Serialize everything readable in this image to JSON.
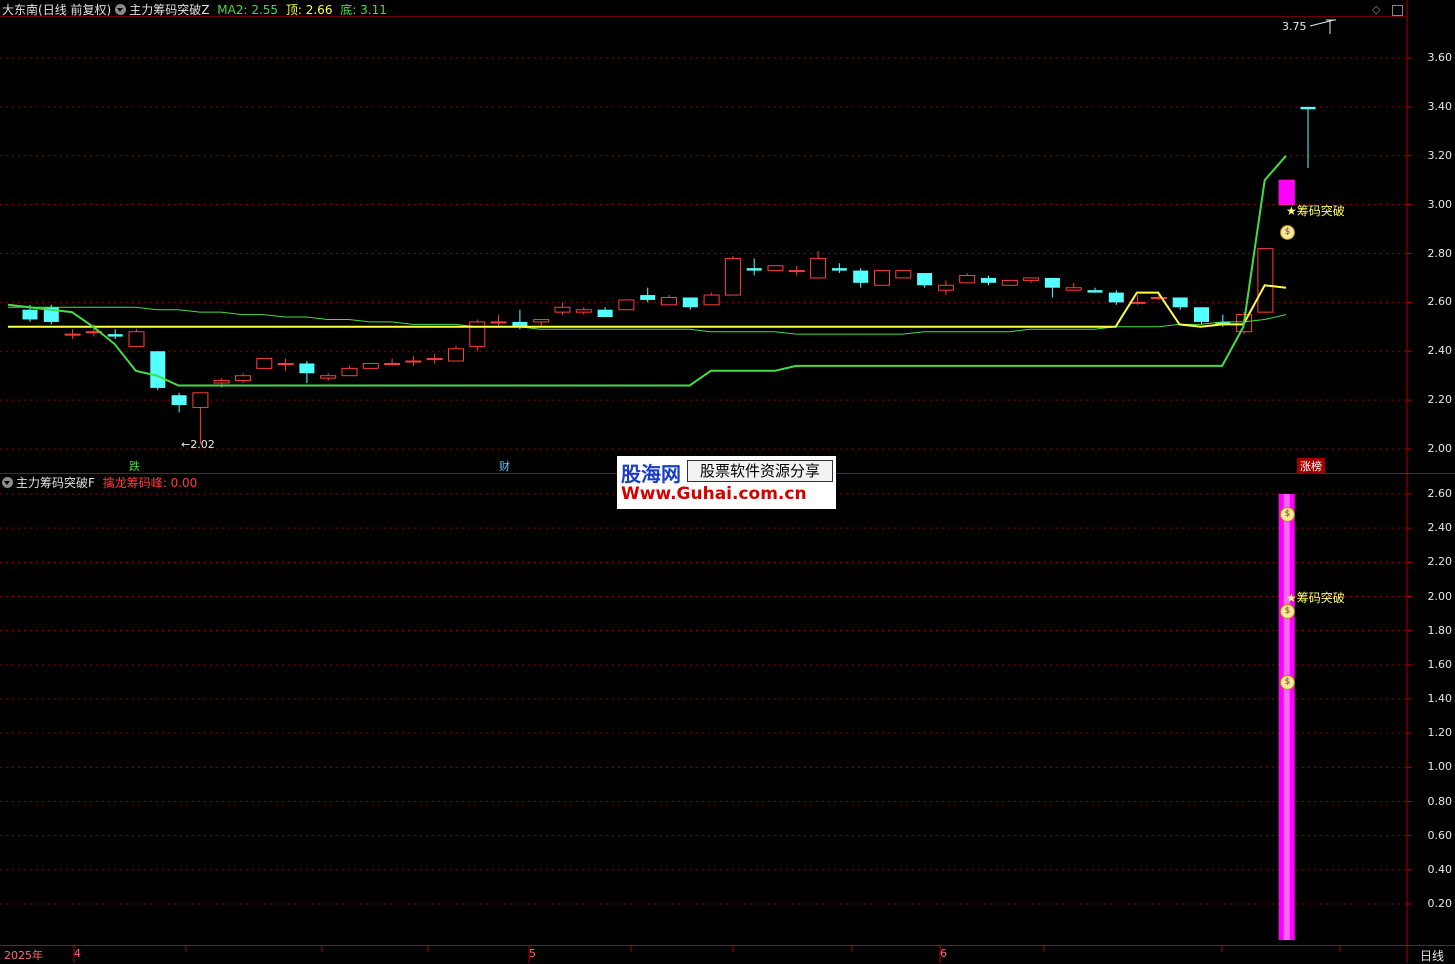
{
  "upper_panel": {
    "stock_name": "大东南",
    "period_info": "(日线 前复权)",
    "indicator_name": "主力筹码突破Z",
    "ma2_label": "MA2: 2.55",
    "top_label": "顶: 2.66",
    "bottom_label": "底: 3.11",
    "y_ticks": [
      "3.60",
      "3.40",
      "3.20",
      "3.00",
      "2.80",
      "2.60",
      "2.40",
      "2.20",
      "2.00"
    ],
    "high_annotation": "3.75",
    "low_annotation": "2.02",
    "signal_label": "★筹码突破",
    "markers": {
      "left": "跌",
      "middle": "财",
      "right": "涨榜"
    }
  },
  "lower_panel": {
    "indicator_name": "主力筹码突破F",
    "value_label": "擒龙筹码峰: 0.00",
    "y_ticks": [
      "2.60",
      "2.40",
      "2.20",
      "2.00",
      "1.80",
      "1.60",
      "1.40",
      "1.20",
      "1.00",
      "0.80",
      "0.60",
      "0.40",
      "0.20"
    ],
    "signal_label": "★筹码突破"
  },
  "x_axis": {
    "year_label": "2025年",
    "month_labels": [
      "4",
      "5",
      "6"
    ],
    "period_button": "日线"
  },
  "watermark": {
    "brand": "股海网",
    "slogan": "股票软件资源分享",
    "url": "Www.Guhai.com.cn"
  },
  "colors": {
    "up": "#ff3c3c",
    "down": "#54ffff",
    "ma_green": "#44dd44",
    "ma_yellow": "#ffff44",
    "bar_magenta": "#ff00ff",
    "grid": "#8b0000"
  },
  "icons": {
    "menu": "triangle-down-icon",
    "money": "money-bag-icon"
  },
  "chart_data": {
    "type": "candlestick",
    "ylim": [
      1.95,
      3.8
    ],
    "ohlc": [
      [
        2.57,
        2.59,
        2.52,
        2.53
      ],
      [
        2.58,
        2.59,
        2.51,
        2.52
      ],
      [
        2.47,
        2.49,
        2.45,
        2.47
      ],
      [
        2.48,
        2.51,
        2.46,
        2.48
      ],
      [
        2.47,
        2.49,
        2.45,
        2.46
      ],
      [
        2.42,
        2.49,
        2.42,
        2.48
      ],
      [
        2.4,
        2.4,
        2.24,
        2.25
      ],
      [
        2.22,
        2.23,
        2.15,
        2.18
      ],
      [
        2.17,
        2.23,
        2.02,
        2.23
      ],
      [
        2.27,
        2.29,
        2.25,
        2.28
      ],
      [
        2.28,
        2.31,
        2.27,
        2.3
      ],
      [
        2.33,
        2.37,
        2.33,
        2.37
      ],
      [
        2.35,
        2.37,
        2.32,
        2.35
      ],
      [
        2.35,
        2.36,
        2.27,
        2.31
      ],
      [
        2.29,
        2.31,
        2.28,
        2.3
      ],
      [
        2.3,
        2.34,
        2.3,
        2.33
      ],
      [
        2.33,
        2.35,
        2.33,
        2.35
      ],
      [
        2.35,
        2.37,
        2.34,
        2.35
      ],
      [
        2.36,
        2.38,
        2.34,
        2.36
      ],
      [
        2.37,
        2.39,
        2.35,
        2.37
      ],
      [
        2.36,
        2.42,
        2.36,
        2.41
      ],
      [
        2.42,
        2.53,
        2.4,
        2.52
      ],
      [
        2.52,
        2.55,
        2.5,
        2.52
      ],
      [
        2.52,
        2.57,
        2.49,
        2.5
      ],
      [
        2.52,
        2.53,
        2.5,
        2.53
      ],
      [
        2.56,
        2.6,
        2.55,
        2.58
      ],
      [
        2.56,
        2.58,
        2.55,
        2.57
      ],
      [
        2.57,
        2.58,
        2.54,
        2.54
      ],
      [
        2.57,
        2.6,
        2.57,
        2.61
      ],
      [
        2.63,
        2.66,
        2.6,
        2.61
      ],
      [
        2.59,
        2.63,
        2.59,
        2.62
      ],
      [
        2.62,
        2.62,
        2.57,
        2.58
      ],
      [
        2.59,
        2.64,
        2.59,
        2.63
      ],
      [
        2.63,
        2.79,
        2.63,
        2.78
      ],
      [
        2.74,
        2.78,
        2.71,
        2.73
      ],
      [
        2.73,
        2.75,
        2.73,
        2.75
      ],
      [
        2.73,
        2.75,
        2.71,
        2.73
      ],
      [
        2.7,
        2.81,
        2.7,
        2.78
      ],
      [
        2.74,
        2.76,
        2.72,
        2.73
      ],
      [
        2.73,
        2.74,
        2.66,
        2.68
      ],
      [
        2.67,
        2.73,
        2.67,
        2.73
      ],
      [
        2.7,
        2.73,
        2.7,
        2.73
      ],
      [
        2.72,
        2.72,
        2.66,
        2.67
      ],
      [
        2.65,
        2.69,
        2.63,
        2.67
      ],
      [
        2.68,
        2.72,
        2.68,
        2.71
      ],
      [
        2.7,
        2.71,
        2.67,
        2.68
      ],
      [
        2.67,
        2.69,
        2.67,
        2.69
      ],
      [
        2.69,
        2.7,
        2.68,
        2.7
      ],
      [
        2.7,
        2.7,
        2.62,
        2.66
      ],
      [
        2.65,
        2.68,
        2.65,
        2.66
      ],
      [
        2.65,
        2.66,
        2.64,
        2.64
      ],
      [
        2.64,
        2.65,
        2.59,
        2.6
      ],
      [
        2.6,
        2.63,
        2.59,
        2.6
      ],
      [
        2.62,
        2.63,
        2.61,
        2.62
      ],
      [
        2.62,
        2.62,
        2.57,
        2.58
      ],
      [
        2.58,
        2.58,
        2.51,
        2.52
      ],
      [
        2.52,
        2.55,
        2.5,
        2.51
      ],
      [
        2.48,
        2.56,
        2.47,
        2.55
      ],
      [
        2.56,
        2.82,
        2.56,
        2.82
      ],
      [
        3.0,
        3.1,
        3.0,
        3.1
      ],
      [
        3.4,
        3.4,
        3.15,
        3.39
      ]
    ],
    "ma_green": [
      2.59,
      2.58,
      2.57,
      2.56,
      2.5,
      2.43,
      2.32,
      2.3,
      2.26,
      2.26,
      2.26,
      2.26,
      2.26,
      2.26,
      2.26,
      2.26,
      2.26,
      2.26,
      2.26,
      2.26,
      2.26,
      2.26,
      2.26,
      2.26,
      2.26,
      2.26,
      2.26,
      2.26,
      2.26,
      2.26,
      2.26,
      2.26,
      2.26,
      2.32,
      2.32,
      2.32,
      2.32,
      2.34,
      2.34,
      2.34,
      2.34,
      2.34,
      2.34,
      2.34,
      2.34,
      2.34,
      2.34,
      2.34,
      2.34,
      2.34,
      2.34,
      2.34,
      2.34,
      2.34,
      2.34,
      2.34,
      2.34,
      2.34,
      2.5,
      3.1,
      3.2
    ],
    "ma_yellow": [
      2.5,
      2.5,
      2.5,
      2.5,
      2.5,
      2.5,
      2.5,
      2.5,
      2.5,
      2.5,
      2.5,
      2.5,
      2.5,
      2.5,
      2.5,
      2.5,
      2.5,
      2.5,
      2.5,
      2.5,
      2.5,
      2.5,
      2.5,
      2.5,
      2.5,
      2.5,
      2.5,
      2.5,
      2.5,
      2.5,
      2.5,
      2.5,
      2.5,
      2.5,
      2.5,
      2.5,
      2.5,
      2.5,
      2.5,
      2.5,
      2.5,
      2.5,
      2.5,
      2.5,
      2.5,
      2.5,
      2.5,
      2.5,
      2.5,
      2.5,
      2.5,
      2.5,
      2.5,
      2.64,
      2.64,
      2.51,
      2.5,
      2.51,
      2.51,
      2.67,
      2.66
    ],
    "ma_thin_green": [
      2.58,
      2.58,
      2.58,
      2.58,
      2.58,
      2.58,
      2.58,
      2.57,
      2.57,
      2.56,
      2.56,
      2.55,
      2.55,
      2.54,
      2.54,
      2.53,
      2.53,
      2.52,
      2.52,
      2.51,
      2.51,
      2.51,
      2.5,
      2.5,
      2.5,
      2.49,
      2.49,
      2.49,
      2.49,
      2.49,
      2.49,
      2.49,
      2.49,
      2.48,
      2.48,
      2.48,
      2.48,
      2.47,
      2.47,
      2.47,
      2.47,
      2.47,
      2.47,
      2.48,
      2.48,
      2.48,
      2.48,
      2.48,
      2.49,
      2.49,
      2.49,
      2.49,
      2.5,
      2.5,
      2.5,
      2.51,
      2.51,
      2.52,
      2.52,
      2.53,
      2.55
    ],
    "lower_bar": {
      "index": 59,
      "value": 2.6
    }
  }
}
